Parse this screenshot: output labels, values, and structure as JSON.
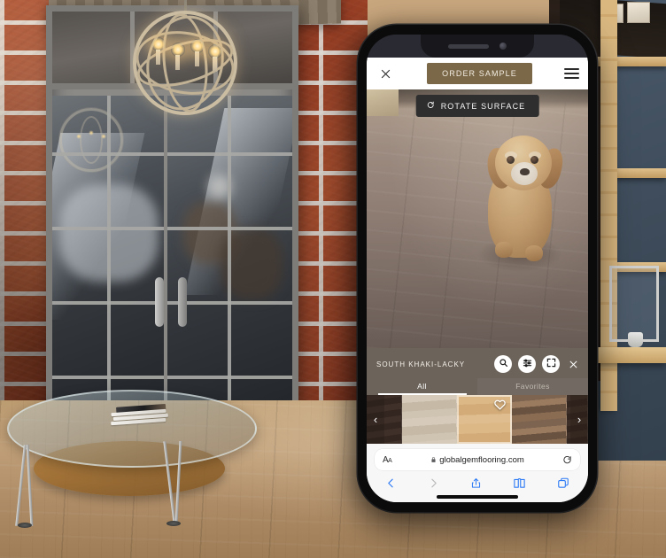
{
  "scene": {
    "description": "industrial loft interior with brick wall, french doors, orb chandelier, glass coffee table and light oak flooring"
  },
  "phone": {
    "device": "smartphone-mockup",
    "status_bar": {
      "speaker": "speaker-grille",
      "camera": "front-camera"
    }
  },
  "app": {
    "top_bar": {
      "close_label": "✕",
      "close_icon": "close-icon",
      "order_sample_label": "ORDER SAMPLE",
      "menu_icon": "hamburger-menu-icon"
    },
    "ar_view": {
      "rotate_label": "ROTATE SURFACE",
      "rotate_icon": "rotate-icon",
      "subject": "dog-standing-on-floor"
    },
    "catalog": {
      "product_name": "SOUTH KHAKI-LACKY",
      "actions": [
        {
          "name": "search-button",
          "icon": "search-icon"
        },
        {
          "name": "filter-button",
          "icon": "filter-sliders-icon"
        },
        {
          "name": "fullscreen-button",
          "icon": "fullscreen-expand-icon"
        }
      ],
      "close_label": "✕",
      "tabs": [
        {
          "label": "All",
          "active": true
        },
        {
          "label": "Favorites",
          "active": false
        }
      ],
      "prev_arrow": "‹",
      "next_arrow": "›",
      "favorite_icon": "heart-icon",
      "swatches": [
        {
          "name": "swatch-1",
          "tone": "dark-walnut",
          "selected": false,
          "favorited": false
        },
        {
          "name": "swatch-2",
          "tone": "pale-grey-oak",
          "selected": false,
          "favorited": false
        },
        {
          "name": "swatch-3",
          "tone": "khaki-oak",
          "selected": true,
          "favorited": true
        },
        {
          "name": "swatch-4",
          "tone": "rustic-reclaimed",
          "selected": false,
          "favorited": false
        },
        {
          "name": "swatch-5",
          "tone": "dark-walnut",
          "selected": false,
          "favorited": false
        }
      ]
    }
  },
  "browser": {
    "text_size_label": "AA",
    "lock_icon": "lock-icon",
    "url": "globalgemflooring.com",
    "reload_icon": "reload-icon",
    "toolbar": [
      {
        "name": "back-button",
        "icon": "chevron-left-icon",
        "enabled": true
      },
      {
        "name": "forward-button",
        "icon": "chevron-right-icon",
        "enabled": false
      },
      {
        "name": "share-button",
        "icon": "share-icon",
        "enabled": true
      },
      {
        "name": "bookmarks-button",
        "icon": "book-icon",
        "enabled": true
      },
      {
        "name": "tabs-button",
        "icon": "tabs-icon",
        "enabled": true
      }
    ]
  },
  "colors": {
    "order_sample_bg": "#7b6848",
    "rotate_bg": "#2e2e2e",
    "catalog_overlay": "rgba(66,56,45,.78)",
    "safari_blue": "#2f7cf6",
    "brick": "#a6472a",
    "floor": "#caa779"
  }
}
